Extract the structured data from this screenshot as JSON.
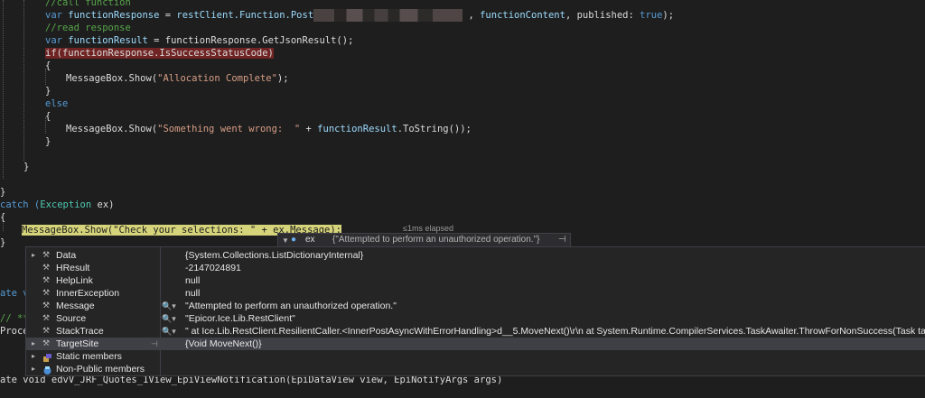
{
  "code": {
    "l1_comment": "//call function",
    "l2_var": "var",
    "l2_ident": "functionResponse",
    "l2_eq": " = ",
    "l2_call": "restClient.Function.Post",
    "l2_rest": " , ",
    "l2_arg": "functionContent",
    "l2_published": ", published: ",
    "l2_true": "true",
    "l2_end": ");",
    "l3_comment": "//read response",
    "l4_var": "var",
    "l4_ident": "functionResult",
    "l4_eq": " = ",
    "l4_call": "functionResponse.GetJsonResult();",
    "l5_if": "if(functionResponse.IsSuccessStatusCode)",
    "l6": "{",
    "l7_call": "MessageBox.Show(",
    "l7_str": "\"Allocation Complete\"",
    "l7_end": ");",
    "l8": "}",
    "l9": "else",
    "l10": "{",
    "l11_call": "MessageBox.Show(",
    "l11_str": "\"Something went wrong:  \"",
    "l11_plus": " + ",
    "l11_ident": "functionResult",
    "l11_end": ".ToString());",
    "l12": "}",
    "l13": "}",
    "l14": "}",
    "l15_catch": "catch (",
    "l15_type": "Exception",
    "l15_ex": " ex)",
    "l16": "{",
    "l17_highlight": "MessageBox.Show(\"Check your selections: \" + ex.Message);",
    "l18": "}",
    "elapsed": "≤1ms elapsed",
    "left_frag1": "ate v",
    "left_frag2": "// **",
    "left_frag3": "Proce",
    "bottom_line": "ate void edvV_JRF_Quotes_1View_EpiViewNotification(EpiDataView view, EpiNotifyArgs args)"
  },
  "datatip": {
    "variable": "ex",
    "value": "{\"Attempted to perform an unauthorized operation.\"}",
    "pin_glyph": "⊣"
  },
  "properties": [
    {
      "name": "Data",
      "value": "{System.Collections.ListDictionaryInternal}",
      "icon": "wrench-icon",
      "magnifier": false,
      "expandable": true
    },
    {
      "name": "HResult",
      "value": "-2147024891",
      "icon": "wrench-icon",
      "magnifier": false,
      "expandable": false
    },
    {
      "name": "HelpLink",
      "value": "null",
      "icon": "wrench-icon",
      "magnifier": false,
      "expandable": false
    },
    {
      "name": "InnerException",
      "value": "null",
      "icon": "wrench-icon",
      "magnifier": false,
      "expandable": false
    },
    {
      "name": "Message",
      "value": "\"Attempted to perform an unauthorized operation.\"",
      "icon": "wrench-icon",
      "magnifier": true,
      "expandable": false
    },
    {
      "name": "Source",
      "value": "\"Epicor.Ice.Lib.RestClient\"",
      "icon": "wrench-icon",
      "magnifier": true,
      "expandable": false
    },
    {
      "name": "StackTrace",
      "value": "\"   at Ice.Lib.RestClient.ResilientCaller.<InnerPostAsyncWithErrorHandling>d__5.MoveNext()\\r\\n   at System.Runtime.CompilerServices.TaskAwaiter.ThrowForNonSuccess(Task task)\\r\\n",
      "icon": "wrench-icon",
      "magnifier": true,
      "expandable": false
    },
    {
      "name": "TargetSite",
      "value": "{Void MoveNext()}",
      "icon": "wrench-icon",
      "magnifier": false,
      "expandable": true,
      "selected": true
    },
    {
      "name": "Static members",
      "value": "",
      "icon": "static-members-icon",
      "magnifier": false,
      "expandable": true
    },
    {
      "name": "Non-Public members",
      "value": "",
      "icon": "non-public-members-icon",
      "magnifier": false,
      "expandable": true
    }
  ]
}
